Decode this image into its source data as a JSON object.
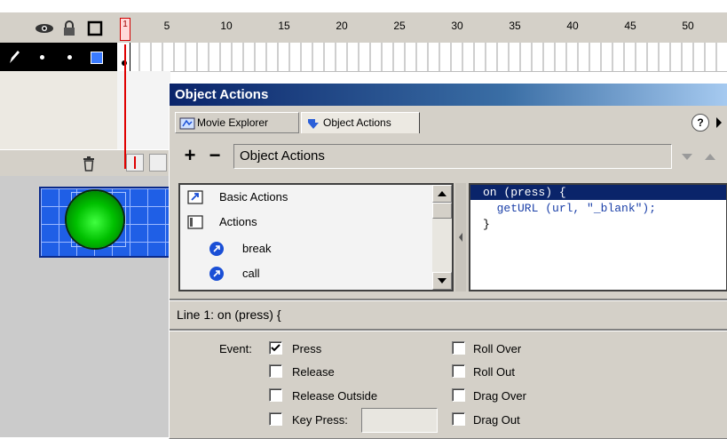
{
  "timeline": {
    "frame_numbers": [
      "1",
      "5",
      "10",
      "15",
      "20",
      "25",
      "30",
      "35",
      "40",
      "45",
      "50"
    ],
    "layer_icons": [
      "eye-icon",
      "lock-icon",
      "outline-icon",
      "pencil-icon"
    ]
  },
  "panel": {
    "title": "Object Actions",
    "tabs": [
      {
        "label": "Movie Explorer",
        "icon": "movie-explorer-icon"
      },
      {
        "label": "Object Actions",
        "icon": "object-actions-icon"
      }
    ],
    "help_label": "?",
    "toolbar": {
      "add_label": "+",
      "remove_label": "−",
      "category_select": "Object Actions"
    },
    "toolbox_items": [
      {
        "label": "Basic Actions",
        "icon": "book-arrow-icon"
      },
      {
        "label": "Actions",
        "icon": "book-icon"
      },
      {
        "label": "break",
        "icon": "action-circle-icon"
      },
      {
        "label": "call",
        "icon": "action-circle-icon"
      }
    ],
    "code_lines": [
      "on (press) {",
      "  getURL (url, \"_blank\");",
      "}"
    ],
    "status_line": "Line 1: on (press) {",
    "event_label": "Event:",
    "events_left": [
      {
        "label": "Press",
        "checked": true
      },
      {
        "label": "Release",
        "checked": false
      },
      {
        "label": "Release Outside",
        "checked": false
      },
      {
        "label": "Key Press:",
        "checked": false
      }
    ],
    "events_right": [
      {
        "label": "Roll Over",
        "checked": false
      },
      {
        "label": "Roll Out",
        "checked": false
      },
      {
        "label": "Drag Over",
        "checked": false
      },
      {
        "label": "Drag Out",
        "checked": false
      }
    ],
    "keypress_value": ""
  },
  "colors": {
    "title_gradient_start": "#0a246a",
    "selection": "#0a246a",
    "stage_grid": "#1a4fd6",
    "button_green": "#00c000"
  }
}
